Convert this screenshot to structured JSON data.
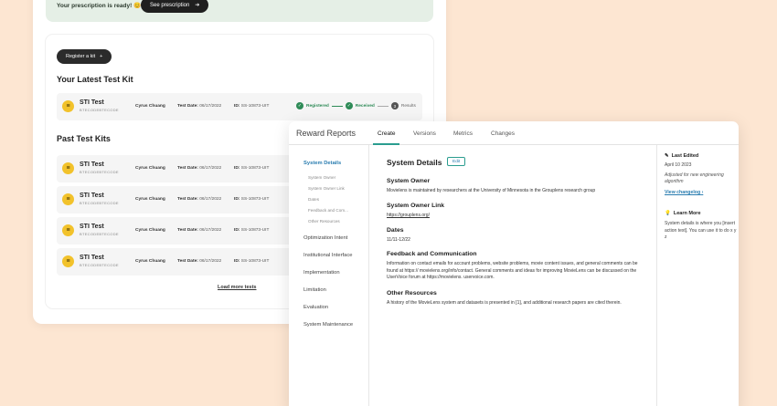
{
  "banner": {
    "text": "Your prescription is ready! 😊",
    "button": "See prescription"
  },
  "kits_panel": {
    "register_label": "Register a kit",
    "latest_title": "Your Latest Test Kit",
    "past_title": "Past Test Kits",
    "load_more": "Load more tests",
    "date_label": "Test Date:",
    "id_label": "ID:",
    "latest": {
      "name": "STI Test",
      "code": "BTECODEBTECODE",
      "owner": "Cyrus Chuang",
      "date": "06/17/2022",
      "id": "SS-10873-UIT",
      "steps": [
        "Registered",
        "Received",
        "Results"
      ],
      "step3_num": "3"
    },
    "past": [
      {
        "name": "STI Test",
        "code": "BTECODEBTECODE",
        "owner": "Cyrus Chuang",
        "date": "06/17/2022",
        "id": "SS-10873-UIT"
      },
      {
        "name": "STI Test",
        "code": "BTECODEBTECODE",
        "owner": "Cyrus Chuang",
        "date": "06/17/2022",
        "id": "SS-10873-UIT"
      },
      {
        "name": "STI Test",
        "code": "BTECODEBTECODE",
        "owner": "Cyrus Chuang",
        "date": "06/17/2022",
        "id": "SS-10873-UIT"
      },
      {
        "name": "STI Test",
        "code": "BTECODEBTECODE",
        "owner": "Cyrus Chuang",
        "date": "06/17/2022",
        "id": "SS-10873-UIT"
      }
    ]
  },
  "reward": {
    "title": "Reward Reports",
    "tabs": [
      "Create",
      "Versions",
      "Metrics",
      "Changes"
    ],
    "nav": {
      "system_details": "System Details",
      "subs": [
        "System Owner",
        "System Owner Link",
        "Dates",
        "Feedback and Com...",
        "Other Resources"
      ],
      "items": [
        "Optimization Intent",
        "Institutional Interface",
        "Implementation",
        "Limitation",
        "Evaluation",
        "System Maintenance"
      ]
    },
    "main": {
      "title": "System Details",
      "edit": "Edit",
      "owner_h": "System Owner",
      "owner_t": "Movielens is maintained by researchers at the University of Minnesota in the Grouplens research group",
      "link_h": "System Owner Link",
      "link_t": "https://grouplens.org/",
      "dates_h": "Dates",
      "dates_t": "11/11-12/22",
      "feedback_h": "Feedback and Communication",
      "feedback_t": "Information on contact emails for account problems, website problems, movie content issues, and general comments can be found at https:// movielens.org/info/contact. General comments and ideas for improving MovieLens can be discussed on the UserVoice forum at https://movielens. uservoice.com.",
      "other_h": "Other Resources",
      "other_t": "A history of the MovieLens system and datasets is presented in [1], and additional research papers are cited therein."
    },
    "side": {
      "last_edited_h": "Last Edited",
      "last_edited_date": "April 10 2023",
      "last_edited_note": "Adjusted for new engineering algorithm",
      "changelog": "View changelog",
      "learn_h": "Learn More",
      "learn_t": "System details is where you [insert action text]. You can use it to do x y z"
    }
  },
  "colors": {
    "background": "#fde6d2",
    "accent": "#2a9d8f",
    "link": "#2a7db0",
    "success": "#2e8b57",
    "kit_icon": "#f2c22b"
  }
}
